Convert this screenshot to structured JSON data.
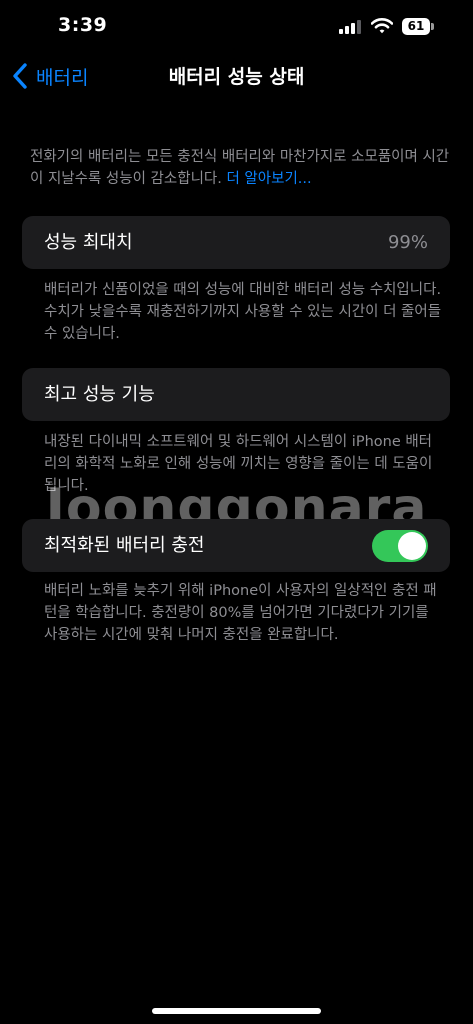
{
  "status_bar": {
    "time": "3:39",
    "battery_level": "61",
    "icons": [
      "signal-icon",
      "wifi-icon",
      "battery-icon"
    ]
  },
  "nav": {
    "back_label": "배터리",
    "title": "배터리 성능 상태",
    "back_icon": "chevron-left-icon"
  },
  "intro": {
    "text": "전화기의 배터리는 모든 충전식 배터리와 마찬가지로 소모품이며 시간이 지날수록 성능이 감소합니다. ",
    "link": "더 알아보기..."
  },
  "max_capacity": {
    "label": "성능 최대치",
    "value": "99%",
    "footer": "배터리가 신품이었을 때의 성능에 대비한 배터리 성능 수치입니다. 수치가 낮을수록 재충전하기까지 사용할 수 있는 시간이 더 줄어들 수 있습니다."
  },
  "peak_performance": {
    "label": "최고 성능 기능",
    "footer": "내장된 다이내믹 소프트웨어 및 하드웨어 시스템이 iPhone 배터리의 화학적 노화로 인해 성능에 끼치는 영향을 줄이는 데 도움이 됩니다."
  },
  "optimized_charging": {
    "label": "최적화된 배터리 충전",
    "enabled": true,
    "footer": "배터리 노화를 늦추기 위해 iPhone이 사용자의 일상적인 충전 패턴을 학습합니다. 충전량이 80%를 넘어가면 기다렸다가 기기를 사용하는 시간에 맞춰 나머지 충전을 완료합니다."
  },
  "watermark": "Joonggonara",
  "colors": {
    "background": "#000000",
    "cell": "#1c1c1e",
    "accent": "#0a84ff",
    "secondary_text": "#8e8e93",
    "toggle_on": "#34c759"
  }
}
